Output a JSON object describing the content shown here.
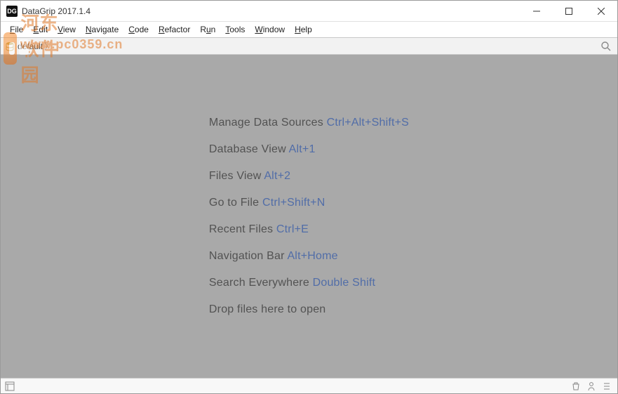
{
  "titlebar": {
    "icon_text": "DG",
    "title": "DataGrip 2017.1.4"
  },
  "menu": {
    "file": {
      "u": "F",
      "rest": "ile"
    },
    "edit": {
      "u": "E",
      "rest": "dit"
    },
    "view": {
      "u": "V",
      "rest": "iew"
    },
    "navigate": {
      "u": "N",
      "rest": "avigate"
    },
    "code": {
      "u": "C",
      "rest": "ode"
    },
    "refactor": {
      "u": "R",
      "rest": "efactor"
    },
    "run": {
      "pre": "R",
      "u": "u",
      "rest": "n"
    },
    "tools": {
      "u": "T",
      "rest": "ools"
    },
    "window": {
      "u": "W",
      "rest": "indow"
    },
    "help": {
      "u": "H",
      "rest": "elp"
    }
  },
  "navbar": {
    "crumb": "default"
  },
  "tips": [
    {
      "label": "Manage Data Sources",
      "shortcut": "Ctrl+Alt+Shift+S"
    },
    {
      "label": "Database View",
      "shortcut": "Alt+1"
    },
    {
      "label": "Files View",
      "shortcut": "Alt+2"
    },
    {
      "label": "Go to File",
      "shortcut": "Ctrl+Shift+N"
    },
    {
      "label": "Recent Files",
      "shortcut": "Ctrl+E"
    },
    {
      "label": "Navigation Bar",
      "shortcut": "Alt+Home"
    },
    {
      "label": "Search Everywhere",
      "shortcut": "Double Shift"
    },
    {
      "label": "Drop files here to open",
      "shortcut": ""
    }
  ],
  "watermark": {
    "line1": "河东软件园",
    "line2": "www.pc0359.cn"
  }
}
